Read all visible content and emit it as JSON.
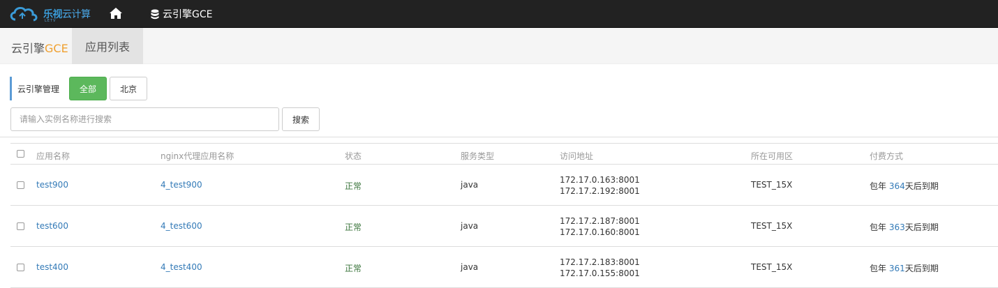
{
  "topbar": {
    "logo_text_a": "乐视",
    "logo_text_b": "云计算",
    "logo_sub": "LETV",
    "home_icon": "home-icon",
    "nav_item": "云引擎GCE",
    "nav_icon": "database-icon"
  },
  "breadcrumb": {
    "first_plain": "云引擎",
    "first_accent": "GCE",
    "active": "应用列表",
    "accent_color": "#f0a030"
  },
  "filter": {
    "label": "云引擎管理",
    "options": [
      "全部",
      "北京"
    ],
    "selected": "全部",
    "selected_color": "#5cb85c"
  },
  "search": {
    "placeholder": "请输入实例名称进行搜索",
    "button": "搜索"
  },
  "table": {
    "headers": [
      "应用名称",
      "nginx代理应用名称",
      "状态",
      "服务类型",
      "访问地址",
      "所在可用区",
      "付费方式"
    ],
    "rows": [
      {
        "name": "test900",
        "nginx": "4_test900",
        "status": "正常",
        "type": "java",
        "addr1": "172.17.0.163:8001",
        "addr2": "172.17.2.192:8001",
        "zone": "TEST_15X",
        "pay_prefix": "包年",
        "pay_days": "364",
        "pay_suffix": "天后到期"
      },
      {
        "name": "test600",
        "nginx": "4_test600",
        "status": "正常",
        "type": "java",
        "addr1": "172.17.2.187:8001",
        "addr2": "172.17.0.160:8001",
        "zone": "TEST_15X",
        "pay_prefix": "包年",
        "pay_days": "363",
        "pay_suffix": "天后到期"
      },
      {
        "name": "test400",
        "nginx": "4_test400",
        "status": "正常",
        "type": "java",
        "addr1": "172.17.2.183:8001",
        "addr2": "172.17.0.155:8001",
        "zone": "TEST_15X",
        "pay_prefix": "包年",
        "pay_days": "361",
        "pay_suffix": "天后到期"
      }
    ]
  }
}
